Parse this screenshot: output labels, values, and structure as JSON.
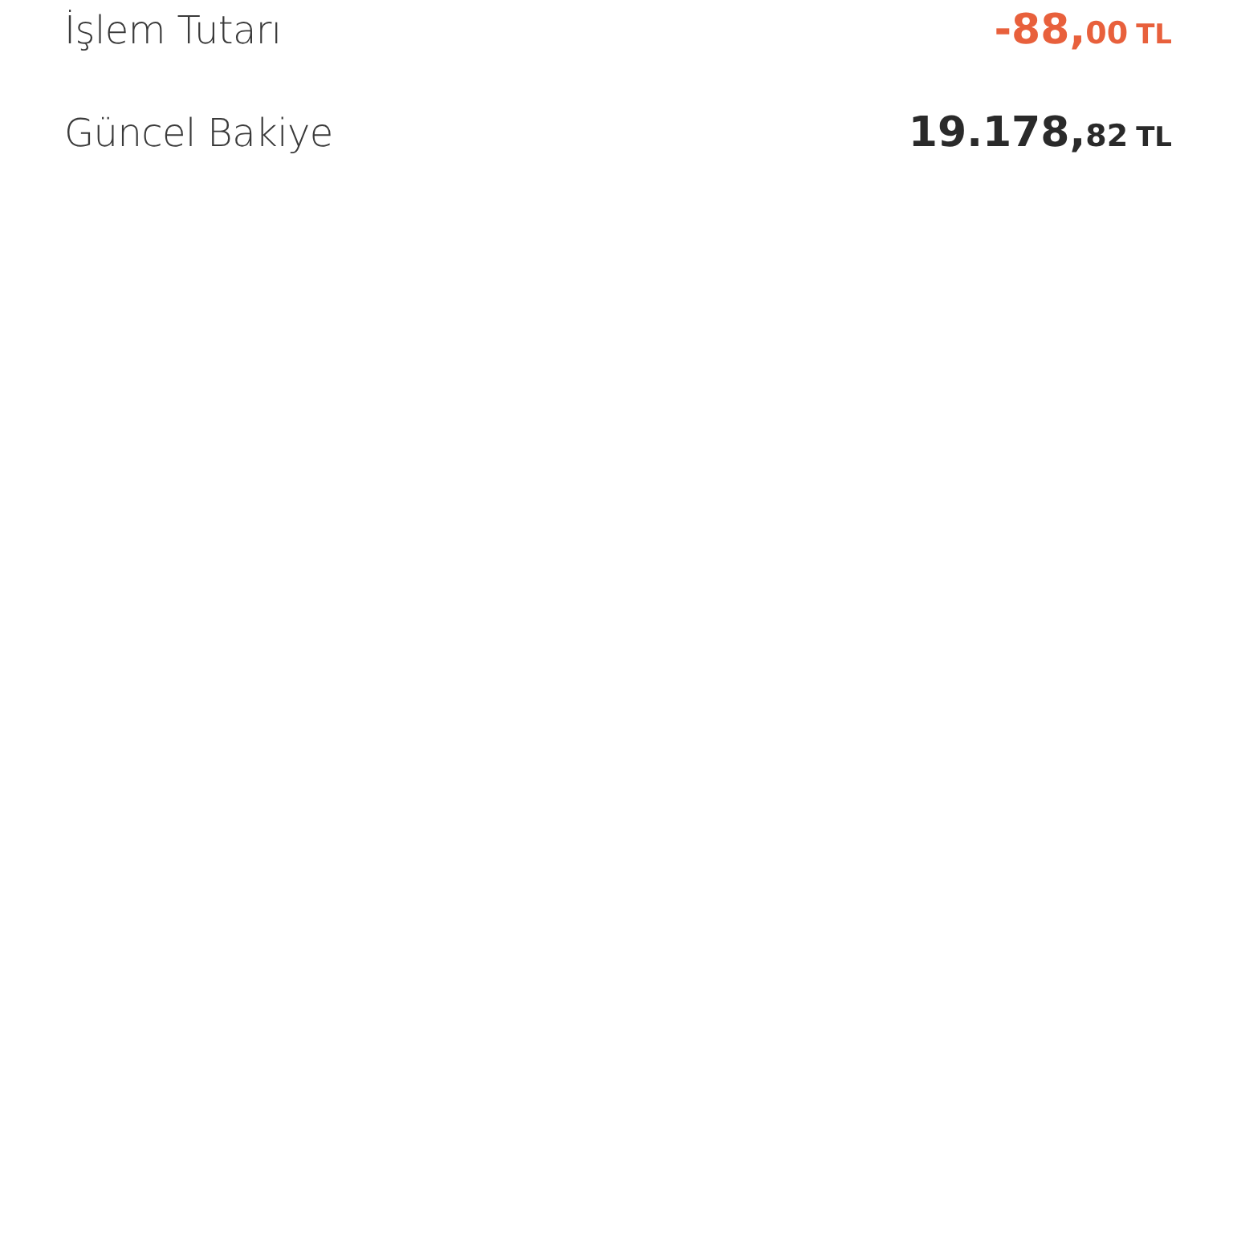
{
  "rows": [
    {
      "label": "İşlem Tutarı",
      "kind": "debit",
      "amount": {
        "whole": "-88,",
        "fraction": "00",
        "currency": "TL"
      }
    },
    {
      "label": "Güncel Bakiye",
      "kind": "balance",
      "amount": {
        "whole": "19.178,",
        "fraction": "82",
        "currency": "TL"
      }
    }
  ]
}
